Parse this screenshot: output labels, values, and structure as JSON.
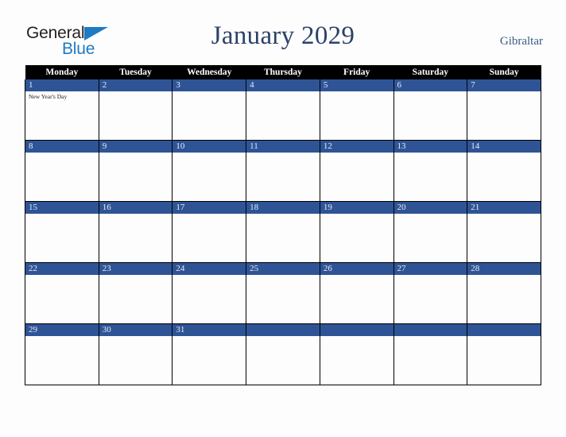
{
  "brand": {
    "line1": "General",
    "line2": "Blue",
    "triangle_color": "#1f7ac4",
    "text_color": "#231f20"
  },
  "header": {
    "title": "January 2029",
    "region": "Gibraltar",
    "title_color": "#2b4268"
  },
  "theme": {
    "day_bar_color": "#2f5496",
    "header_row_bg": "#000000",
    "header_row_text": "#ffffff",
    "page_bg": "#fdfdfd",
    "grid_border": "#000000"
  },
  "calendar": {
    "weekday_headers": [
      "Monday",
      "Tuesday",
      "Wednesday",
      "Thursday",
      "Friday",
      "Saturday",
      "Sunday"
    ],
    "weeks": [
      [
        {
          "num": "1",
          "events": [
            "New Year's Day"
          ]
        },
        {
          "num": "2",
          "events": []
        },
        {
          "num": "3",
          "events": []
        },
        {
          "num": "4",
          "events": []
        },
        {
          "num": "5",
          "events": []
        },
        {
          "num": "6",
          "events": []
        },
        {
          "num": "7",
          "events": []
        }
      ],
      [
        {
          "num": "8",
          "events": []
        },
        {
          "num": "9",
          "events": []
        },
        {
          "num": "10",
          "events": []
        },
        {
          "num": "11",
          "events": []
        },
        {
          "num": "12",
          "events": []
        },
        {
          "num": "13",
          "events": []
        },
        {
          "num": "14",
          "events": []
        }
      ],
      [
        {
          "num": "15",
          "events": []
        },
        {
          "num": "16",
          "events": []
        },
        {
          "num": "17",
          "events": []
        },
        {
          "num": "18",
          "events": []
        },
        {
          "num": "19",
          "events": []
        },
        {
          "num": "20",
          "events": []
        },
        {
          "num": "21",
          "events": []
        }
      ],
      [
        {
          "num": "22",
          "events": []
        },
        {
          "num": "23",
          "events": []
        },
        {
          "num": "24",
          "events": []
        },
        {
          "num": "25",
          "events": []
        },
        {
          "num": "26",
          "events": []
        },
        {
          "num": "27",
          "events": []
        },
        {
          "num": "28",
          "events": []
        }
      ],
      [
        {
          "num": "29",
          "events": []
        },
        {
          "num": "30",
          "events": []
        },
        {
          "num": "31",
          "events": []
        },
        {
          "num": "",
          "events": []
        },
        {
          "num": "",
          "events": []
        },
        {
          "num": "",
          "events": []
        },
        {
          "num": "",
          "events": []
        }
      ]
    ]
  }
}
